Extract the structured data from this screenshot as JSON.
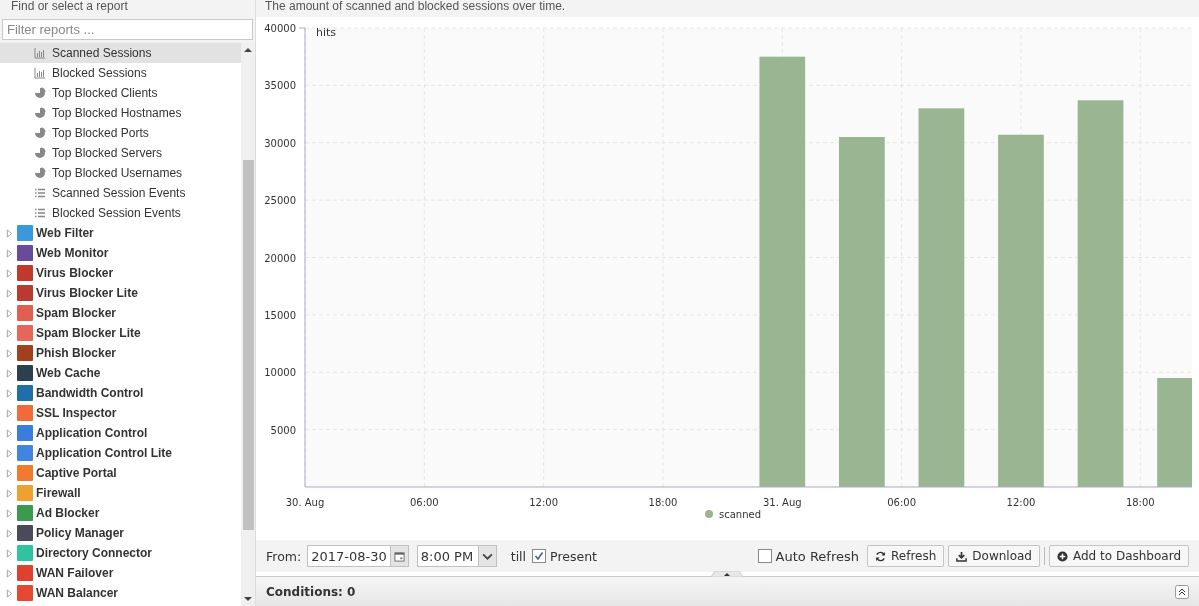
{
  "sidebar": {
    "title": "Find or select a report",
    "filter": {
      "placeholder": "Filter reports ..."
    },
    "reports": [
      {
        "label": "Scanned Sessions",
        "kind": "bar",
        "selected": true
      },
      {
        "label": "Blocked Sessions",
        "kind": "bar",
        "selected": false
      },
      {
        "label": "Top Blocked Clients",
        "kind": "pie",
        "selected": false
      },
      {
        "label": "Top Blocked Hostnames",
        "kind": "pie",
        "selected": false
      },
      {
        "label": "Top Blocked Ports",
        "kind": "pie",
        "selected": false
      },
      {
        "label": "Top Blocked Servers",
        "kind": "pie",
        "selected": false
      },
      {
        "label": "Top Blocked Usernames",
        "kind": "pie",
        "selected": false
      },
      {
        "label": "Scanned Session Events",
        "kind": "list",
        "selected": false
      },
      {
        "label": "Blocked Session Events",
        "kind": "list",
        "selected": false
      }
    ],
    "apps": [
      {
        "label": "Web Filter",
        "color": "#3a9ad9",
        "expanded": false
      },
      {
        "label": "Web Monitor",
        "color": "#6a4a9a",
        "expanded": false
      },
      {
        "label": "Virus Blocker",
        "color": "#c0392b",
        "expanded": false
      },
      {
        "label": "Virus Blocker Lite",
        "color": "#b83a30",
        "expanded": false
      },
      {
        "label": "Spam Blocker",
        "color": "#e06050",
        "expanded": false
      },
      {
        "label": "Spam Blocker Lite",
        "color": "#e8655a",
        "expanded": false
      },
      {
        "label": "Phish Blocker",
        "color": "#a0401c",
        "expanded": false
      },
      {
        "label": "Web Cache",
        "color": "#2c3e50",
        "expanded": false
      },
      {
        "label": "Bandwidth Control",
        "color": "#1f6fa8",
        "expanded": false
      },
      {
        "label": "SSL Inspector",
        "color": "#f06a3a",
        "expanded": false
      },
      {
        "label": "Application Control",
        "color": "#3b7ddd",
        "expanded": false
      },
      {
        "label": "Application Control Lite",
        "color": "#4285e0",
        "expanded": false
      },
      {
        "label": "Captive Portal",
        "color": "#f07a30",
        "expanded": false
      },
      {
        "label": "Firewall",
        "color": "#f0a030",
        "expanded": false
      },
      {
        "label": "Ad Blocker",
        "color": "#3a9a50",
        "expanded": false
      },
      {
        "label": "Policy Manager",
        "color": "#4a4a5a",
        "expanded": false
      },
      {
        "label": "Directory Connector",
        "color": "#2ec4a0",
        "expanded": false
      },
      {
        "label": "WAN Failover",
        "color": "#e04030",
        "expanded": false
      },
      {
        "label": "WAN Balancer",
        "color": "#e44a30",
        "expanded": false
      }
    ]
  },
  "report": {
    "description": "The amount of scanned and blocked sessions over time.",
    "chart_data": {
      "type": "bar",
      "ylabel": "hits",
      "grid": true,
      "x": [
        "2017-08-31T00:00",
        "2017-08-31T04:00",
        "2017-08-31T08:00",
        "2017-08-31T12:00",
        "2017-08-31T16:00",
        "2017-08-31T20:00"
      ],
      "series": [
        {
          "name": "scanned",
          "color": "#9ab591",
          "values": [
            37500,
            30500,
            33000,
            30700,
            33700,
            9500
          ]
        }
      ],
      "xlim": [
        "2017-08-30T00:00",
        "2017-08-31T20:36"
      ],
      "ylim": [
        0,
        40000
      ],
      "xticks": [
        {
          "value": "2017-08-30T00:00",
          "label": "30. Aug"
        },
        {
          "value": "2017-08-30T06:00",
          "label": "06:00"
        },
        {
          "value": "2017-08-30T12:00",
          "label": "12:00"
        },
        {
          "value": "2017-08-30T18:00",
          "label": "18:00"
        },
        {
          "value": "2017-08-31T00:00",
          "label": "31. Aug"
        },
        {
          "value": "2017-08-31T06:00",
          "label": "06:00"
        },
        {
          "value": "2017-08-31T12:00",
          "label": "12:00"
        },
        {
          "value": "2017-08-31T18:00",
          "label": "18:00"
        }
      ],
      "yticks": [
        5000,
        10000,
        15000,
        20000,
        25000,
        30000,
        35000,
        40000
      ]
    }
  },
  "toolbar": {
    "from_label": "From:",
    "date": "2017-08-30",
    "time": "8:00 PM",
    "till_label": "till",
    "present": {
      "label": "Present",
      "checked": true
    },
    "auto_refresh": {
      "label": "Auto Refresh",
      "checked": false
    },
    "refresh": "Refresh",
    "download": "Download",
    "add": "Add to Dashboard"
  },
  "conditions": {
    "label": "Conditions: 0"
  }
}
